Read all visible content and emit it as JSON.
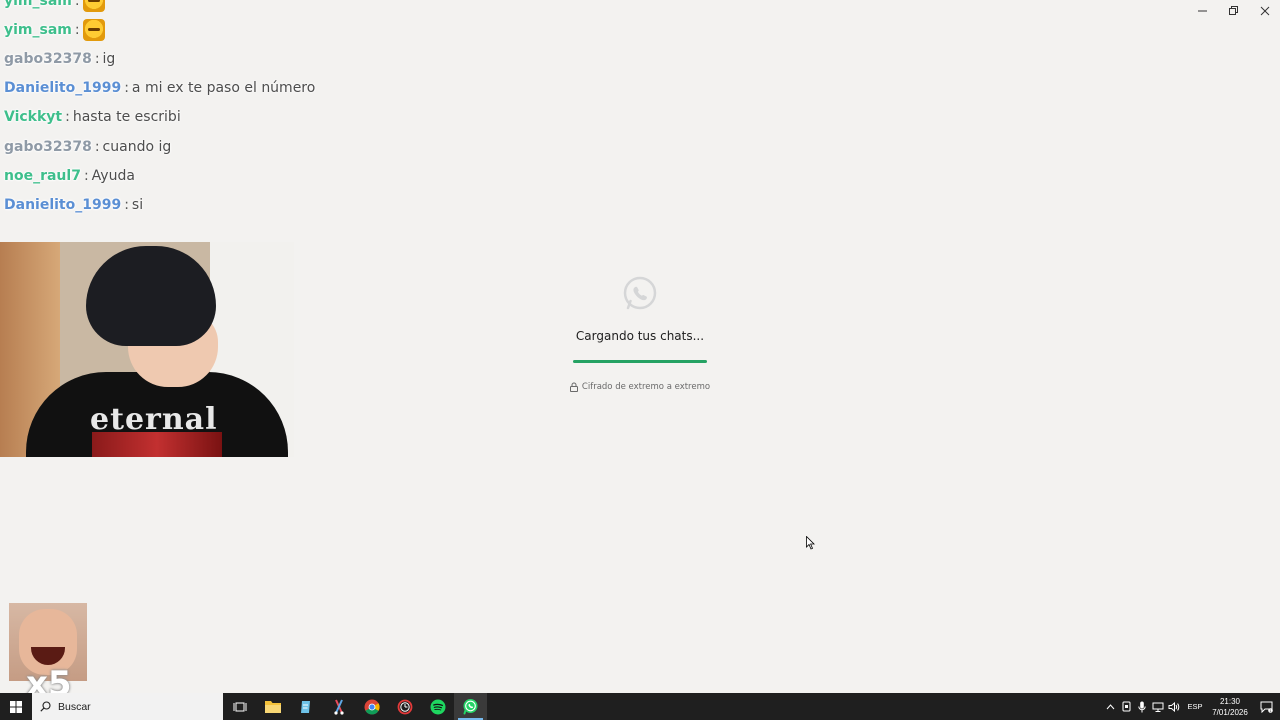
{
  "window": {
    "controls": [
      "minimize",
      "restore",
      "close"
    ]
  },
  "loading": {
    "logo_icon": "whatsapp-logo-icon",
    "text": "Cargando tus chats...",
    "progress": 1.0,
    "progress_color": "#25a263",
    "lock_icon": "lock-icon",
    "encryption_text": "Cifrado de extremo a extremo"
  },
  "chat": [
    {
      "user": "yim_sam",
      "color": "#3ebf8c",
      "emote": true,
      "msg": ""
    },
    {
      "user": "yim_sam",
      "color": "#3ebf8c",
      "emote": true,
      "msg": ""
    },
    {
      "user": "gabo32378",
      "color": "#8f9aa6",
      "emote": false,
      "msg": "ig"
    },
    {
      "user": "Danielito_1999",
      "color": "#5b8fd4",
      "emote": false,
      "msg": "a mi ex te paso el número"
    },
    {
      "user": "Vickkyt",
      "color": "#3ebf8c",
      "emote": false,
      "msg": "hasta te escribi"
    },
    {
      "user": "gabo32378",
      "color": "#8f9aa6",
      "emote": false,
      "msg": "cuando ig"
    },
    {
      "user": "noe_raul7",
      "color": "#3ebf8c",
      "emote": false,
      "msg": "Ayuda"
    },
    {
      "user": "Danielito_1999",
      "color": "#5b8fd4",
      "emote": false,
      "msg": "si"
    }
  ],
  "webcam": {
    "shirt_text": "eternal"
  },
  "emote_popup": {
    "multiplier": "x5"
  },
  "taskbar": {
    "search_label": "Buscar",
    "apps": [
      "task-view-icon",
      "file-explorer-icon",
      "notepad-icon",
      "snipping-tool-icon",
      "chrome-icon",
      "clock-app-icon",
      "spotify-icon",
      "whatsapp-icon"
    ],
    "active_app": "whatsapp-icon",
    "language": "ESP",
    "time": "21:30",
    "date": "7/01/2026"
  }
}
